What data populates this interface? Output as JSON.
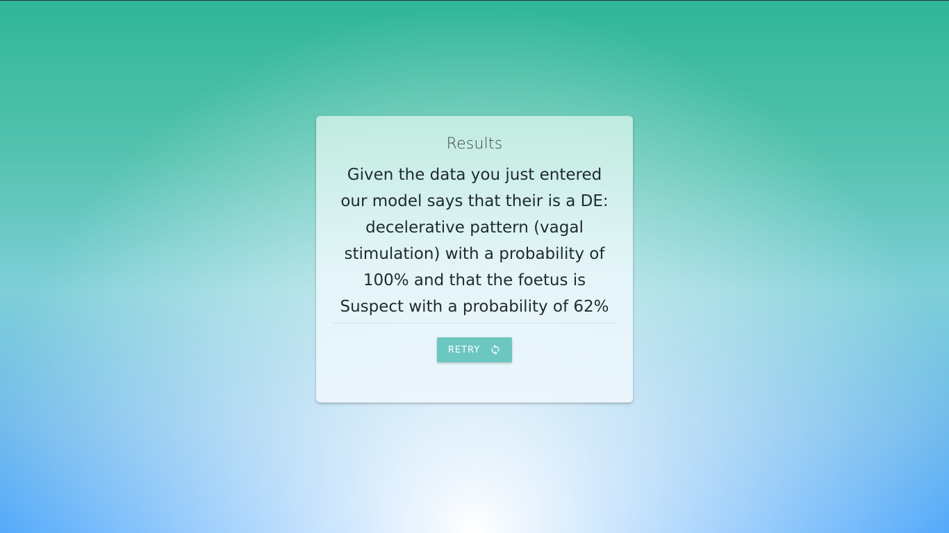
{
  "card": {
    "title": "Results",
    "message": "Given the data you just entered our model says that their is a DE: decelerative pattern (vagal stimulation) with a probability of 100% and that the foetus is Suspect with a probability of 62%",
    "retry_label": "RETRY",
    "retry_icon": "refresh-icon"
  },
  "colors": {
    "button": "#6cc7c0",
    "background_top": "#2fb697",
    "background_bottom": "#4aa5fb"
  }
}
